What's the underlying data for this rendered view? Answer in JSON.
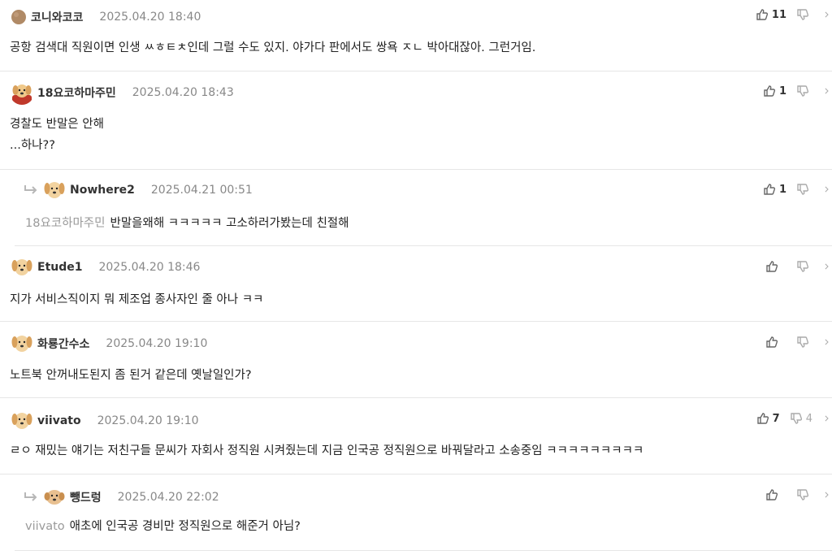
{
  "comments": [
    {
      "author": "코니와코코",
      "time": "2025.04.20 18:40",
      "likes": "11",
      "dislikes": "",
      "lines": [
        "공항 검색대 직원이면 인생 ㅆㅎㅌㅊ인데 그럴 수도 있지. 야가다 판에서도 쌍욕 ㅈㄴ 박아대잖아. 그런거임."
      ],
      "avatar": "round-avatar-icon"
    },
    {
      "author": "18요코하마주민",
      "time": "2025.04.20 18:43",
      "likes": "1",
      "dislikes": "",
      "lines": [
        "경찰도 반말은 안해",
        "...하나??"
      ],
      "avatar": "dog-avatar-icon"
    },
    {
      "author": "Nowhere2",
      "time": "2025.04.21 00:51",
      "likes": "1",
      "dislikes": "",
      "mention": "18요코하마주민",
      "lines": [
        "반말을왜해 ㅋㅋㅋㅋㅋ 고소하러가봤는데 친절해"
      ],
      "avatar": "dog-avatar-icon"
    },
    {
      "author": "Etude1",
      "time": "2025.04.20 18:46",
      "likes": "",
      "dislikes": "",
      "lines": [
        "지가 서비스직이지 뭐 제조업 종사자인 줄 아나 ㅋㅋ"
      ],
      "avatar": "dog-avatar-icon"
    },
    {
      "author": "화룡간수소",
      "time": "2025.04.20 19:10",
      "likes": "",
      "dislikes": "",
      "lines": [
        "노트북 안꺼내도된지 좀 된거 같은데 옛날일인가?"
      ],
      "avatar": "dog-avatar-icon"
    },
    {
      "author": "viivato",
      "time": "2025.04.20 19:10",
      "likes": "7",
      "dislikes": "4",
      "lines": [
        "ㄹㅇ 재밌는 얘기는 저친구들 문씨가 자회사 정직원 시켜줬는데 지금 인국공 정직원으로 바꿔달라고 소송중임 ㅋㅋㅋㅋㅋㅋㅋㅋㅋ"
      ],
      "avatar": "dog-avatar-icon"
    },
    {
      "author": "뺑드렁",
      "time": "2025.04.20 22:02",
      "likes": "",
      "dislikes": "",
      "mention": "viivato",
      "lines": [
        "애초에 인국공 경비만 정직원으로 해준거 아님?"
      ],
      "avatar": "dog-avatar-icon"
    }
  ],
  "icons": {
    "up": "thumbs-up-icon",
    "down": "thumbs-down-icon",
    "more": "more-icon",
    "reply": "reply-arrow-icon"
  }
}
